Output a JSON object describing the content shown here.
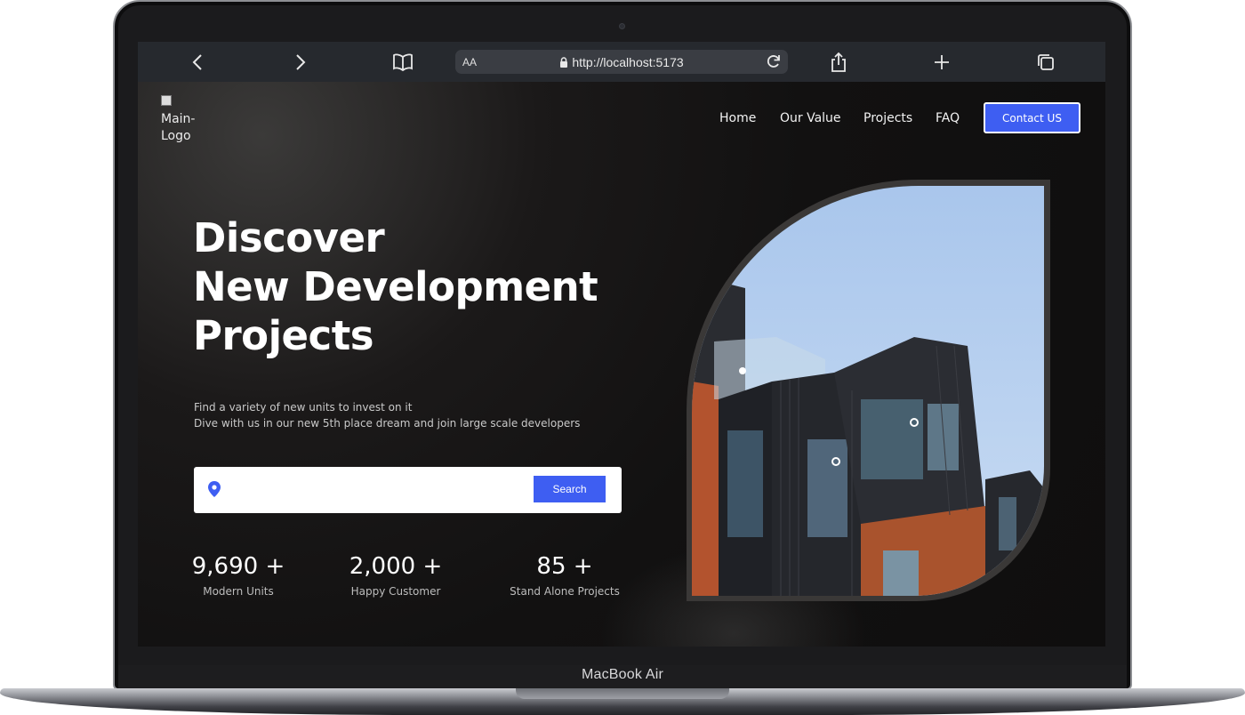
{
  "browser": {
    "text_size_label": "AA",
    "url": "http://localhost:5173",
    "icons": [
      "chevron-left-icon",
      "chevron-right-icon",
      "book-icon",
      "lock-icon",
      "reload-icon",
      "share-icon",
      "plus-icon",
      "tabs-icon"
    ]
  },
  "site": {
    "logo_alt": "Main-Logo",
    "nav": {
      "home": "Home",
      "our_value": "Our Value",
      "projects": "Projects",
      "faq": "FAQ",
      "contact": "Contact US"
    },
    "hero": {
      "title_line1": "Discover",
      "title_line2": "New Development",
      "title_line3": "Projects",
      "subtitle_line1": "Find a variety of new units to invest on it",
      "subtitle_line2": "Dive with us in our new 5th place dream and join large scale developers"
    },
    "search": {
      "value": "",
      "button_label": "Search"
    },
    "stats": [
      {
        "value": "9,690 +",
        "label": "Modern Units"
      },
      {
        "value": "2,000 +",
        "label": "Happy Customer"
      },
      {
        "value": "85 +",
        "label": "Stand Alone Projects"
      }
    ]
  },
  "device": {
    "model_label": "MacBook Air"
  },
  "colors": {
    "accent": "#3e5ef2",
    "page_background": "#0f0e0e",
    "toolbar": "#26292e"
  }
}
